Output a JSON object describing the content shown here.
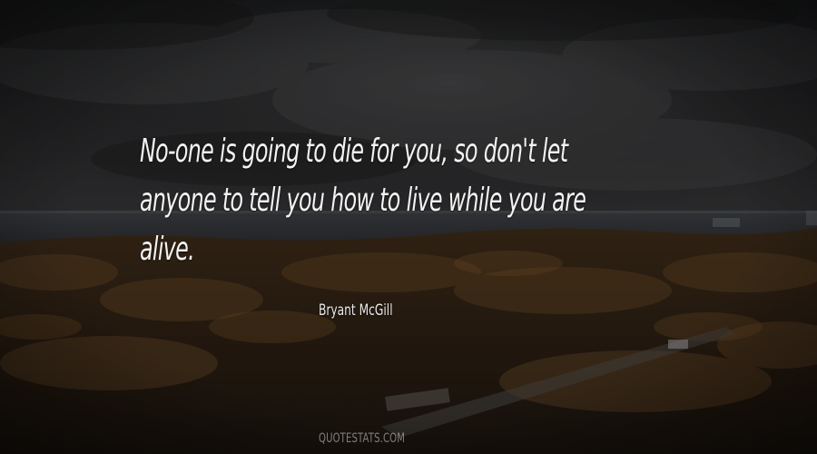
{
  "quote": {
    "lines": [
      "No-one is going to die for you, so don't let",
      "anyone to tell you how to live while you are",
      "alive."
    ]
  },
  "author": "Bryant McGill",
  "watermark": "QUOTESTATS.COM"
}
